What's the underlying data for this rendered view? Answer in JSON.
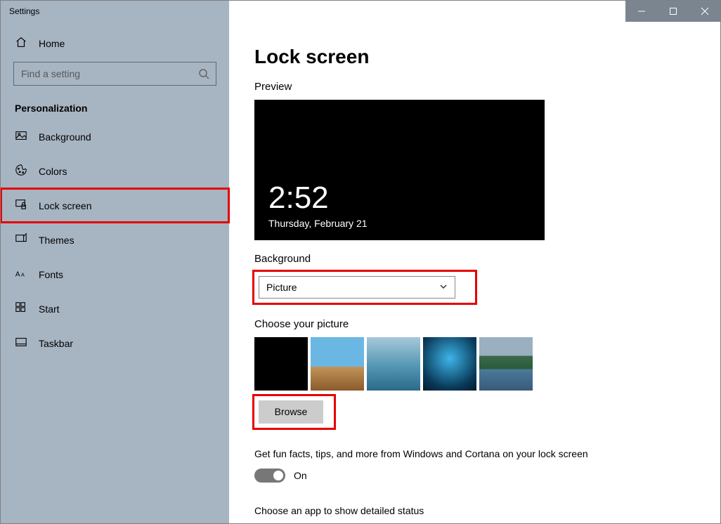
{
  "window_title": "Settings",
  "sidebar": {
    "home_label": "Home",
    "search_placeholder": "Find a setting",
    "category": "Personalization",
    "items": [
      {
        "label": "Background"
      },
      {
        "label": "Colors"
      },
      {
        "label": "Lock screen"
      },
      {
        "label": "Themes"
      },
      {
        "label": "Fonts"
      },
      {
        "label": "Start"
      },
      {
        "label": "Taskbar"
      }
    ]
  },
  "main": {
    "title": "Lock screen",
    "preview_label": "Preview",
    "preview_time": "2:52",
    "preview_date": "Thursday, February 21",
    "background_label": "Background",
    "background_value": "Picture",
    "choose_picture_label": "Choose your picture",
    "browse_label": "Browse",
    "tips_text": "Get fun facts, tips, and more from Windows and Cortana on your lock screen",
    "toggle_label": "On",
    "detailed_status_label": "Choose an app to show detailed status"
  }
}
